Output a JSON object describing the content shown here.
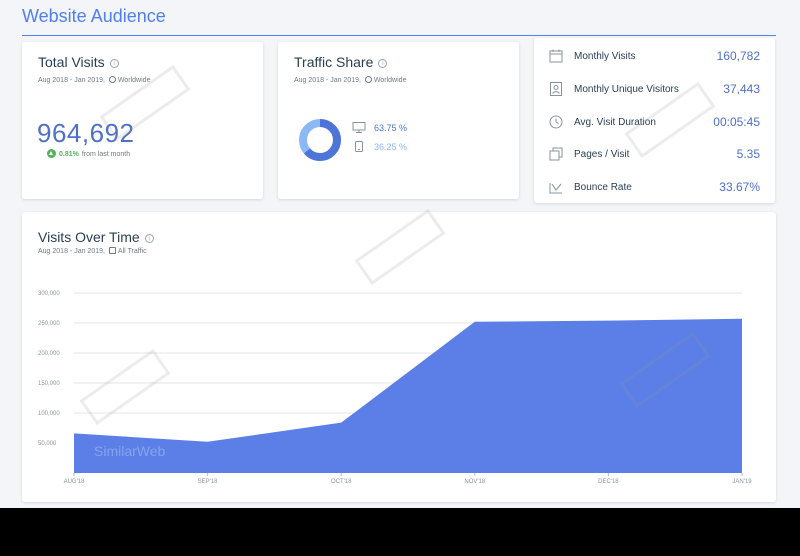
{
  "page": {
    "title": "Website Audience"
  },
  "total_visits": {
    "title": "Total Visits",
    "info_icon": "info-icon",
    "subtitle_range": "Aug 2018 - Jan 2019,",
    "subtitle_region": "Worldwide",
    "value": "964,692",
    "change_value": "0.81%",
    "change_text": "from last month",
    "change_color": "#58b15c"
  },
  "traffic_share": {
    "title": "Traffic Share",
    "subtitle_range": "Aug 2018 - Jan 2019,",
    "subtitle_region": "Worldwide",
    "desktop": {
      "icon": "desktop-icon",
      "value": "63.75 %",
      "share": 63.75,
      "color": "#4f74d8"
    },
    "mobile": {
      "icon": "mobile-icon",
      "value": "36.25 %",
      "share": 36.25,
      "color": "#8cb8f5"
    }
  },
  "stats": [
    {
      "icon": "calendar-icon",
      "label": "Monthly Visits",
      "value": "160,782"
    },
    {
      "icon": "user-card-icon",
      "label": "Monthly Unique Visitors",
      "value": "37,443"
    },
    {
      "icon": "clock-icon",
      "label": "Avg. Visit Duration",
      "value": "00:05:45"
    },
    {
      "icon": "pages-icon",
      "label": "Pages / Visit",
      "value": "5.35"
    },
    {
      "icon": "bounce-icon",
      "label": "Bounce Rate",
      "value": "33.67%"
    }
  ],
  "visits_over_time": {
    "title": "Visits Over Time",
    "subtitle_range": "Aug 2018 - Jan 2019,",
    "subtitle_filter": "All Traffic",
    "watermark": "SimilarWeb"
  },
  "chart_data": {
    "type": "area",
    "x": [
      "AUG'18",
      "SEP'18",
      "OCT'18",
      "NOV'18",
      "DEC'18",
      "JAN'19"
    ],
    "series": [
      {
        "values": [
          66000,
          52000,
          84000,
          252000,
          254000,
          257000
        ]
      }
    ],
    "yticks": [
      50000,
      100000,
      150000,
      200000,
      250000,
      300000
    ],
    "ytick_labels": [
      "50,000",
      "100,000",
      "150,000",
      "200,000",
      "250,000",
      "300,000"
    ],
    "ylim": [
      0,
      300000
    ],
    "grid": true,
    "fill_color": "#5b7fe6"
  },
  "brand": {
    "accent": "#4f7ff5",
    "value_color": "#4f70c9"
  }
}
